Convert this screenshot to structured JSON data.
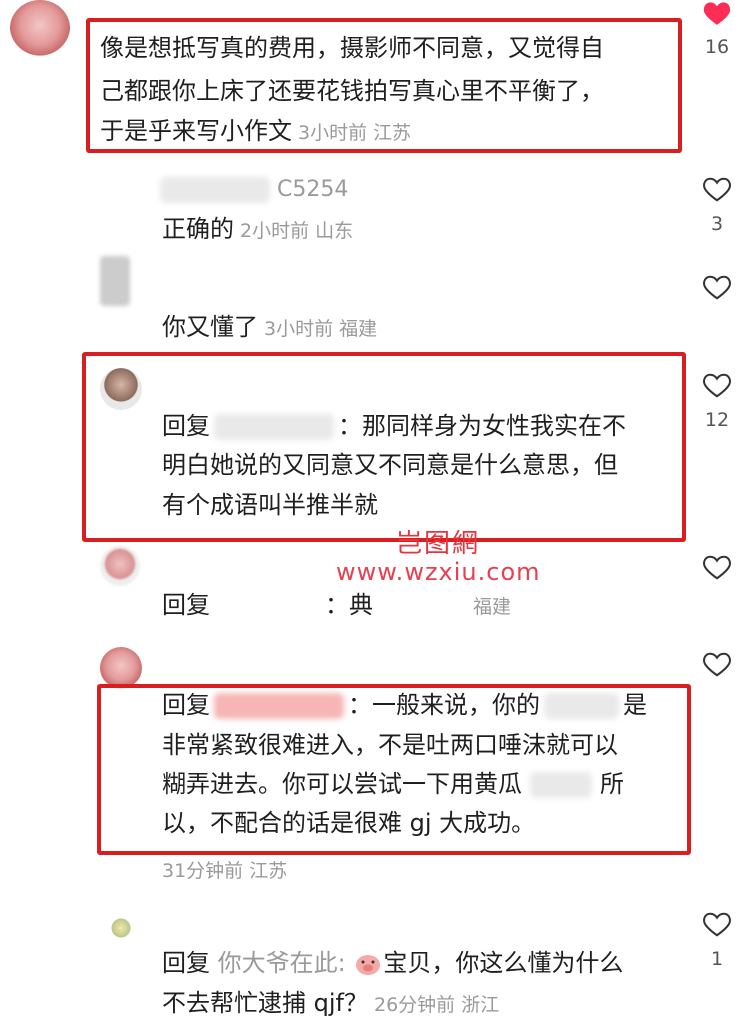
{
  "comments": [
    {
      "line1": "像是想抵写真的费用，摄影师不同意，又觉得自",
      "line2": "己都跟你上床了还要花钱拍写真心里不平衡了，",
      "line3": "于是乎来写小作文",
      "meta": "3小时前 江苏",
      "likes": "16"
    },
    {
      "name": "C5254",
      "text": "正确的",
      "meta": "2小时前 山东",
      "likes": "3"
    },
    {
      "text": "你又懂了",
      "meta": "3小时前 福建"
    },
    {
      "prefix": "回复",
      "line1": "：那同样身为女性我实在不",
      "line2": "明白她说的又同意又不同意是什么意思，但",
      "line3": "有个成语叫半推半就",
      "likes": "12"
    },
    {
      "prefix": "回复",
      "text": "：典",
      "meta": "福建"
    },
    {
      "prefix": "回复",
      "line1": "：一般来说，你的",
      "line1b": "是",
      "line2": "非常紧致很难进入，不是吐两口唾沫就可以",
      "line3": "糊弄进去。你可以尝试一下用黄瓜",
      "line3b": "所",
      "line4": "以，不配合的话是很难 gj 大成功。",
      "meta": "31分钟前 江苏"
    },
    {
      "prefix": "回复",
      "name": "你大爷在此",
      "line1": "宝贝，你这么懂为什么",
      "line2": "不去帮忙逮捕 qjf？",
      "meta": "26分钟前 浙江",
      "likes": "1"
    }
  ],
  "watermark": {
    "logo": "岂图網",
    "url": "www.wzxiu.com"
  },
  "colors": {
    "highlight": "#d81e1e",
    "liked": "#ff2d55"
  },
  "icons": [
    "heart-filled-icon",
    "heart-outline-icon"
  ]
}
